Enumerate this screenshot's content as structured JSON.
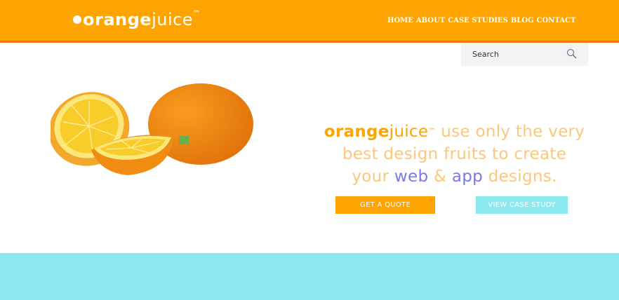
{
  "header": {
    "logo": {
      "bold": "orange",
      "light": "juice",
      "tm": "™"
    },
    "nav": [
      "HOME",
      "ABOUT",
      "CASE STUDIES",
      "BLOG",
      "CONTACT"
    ]
  },
  "search": {
    "placeholder": "Search"
  },
  "hero": {
    "brand_bold": "orange",
    "brand_light": "juice",
    "tm": "™",
    "line1_rest": " use only the very",
    "line2": "best design fruits to create",
    "line3_a": "your ",
    "line3_web": "web",
    "line3_b": " & ",
    "line3_app": "app",
    "line3_c": " designs."
  },
  "buttons": {
    "quote": "GET A QUOTE",
    "case_study": "VIEW CASE STUDY"
  },
  "colors": {
    "orange": "#fea400",
    "cyan": "#8aeaf0",
    "blue": "#7a79e9"
  },
  "icons": {
    "logo_dot": "dot-icon",
    "search": "search-icon",
    "hero_image": "orange-fruit-illustration"
  }
}
